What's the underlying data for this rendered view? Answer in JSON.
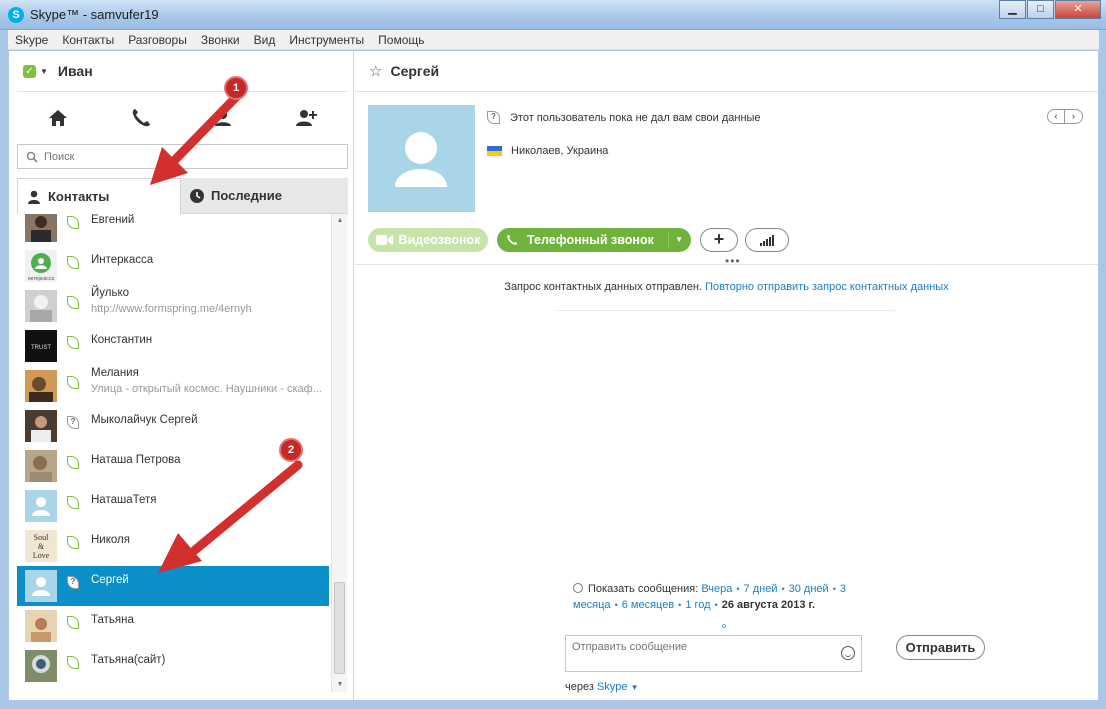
{
  "window": {
    "title": "Skype™ - samvufer19",
    "minimize": "▁",
    "maximize": "□",
    "close": "✕"
  },
  "menu": [
    "Skype",
    "Контакты",
    "Разговоры",
    "Звонки",
    "Вид",
    "Инструменты",
    "Помощь"
  ],
  "me": {
    "name": "Иван",
    "status_icon": "online-check-icon"
  },
  "search": {
    "placeholder": "Поиск"
  },
  "tabs": {
    "contacts": "Контакты",
    "recent": "Последние"
  },
  "contacts": [
    {
      "name": "Евгений",
      "mood": "",
      "status": "online",
      "avatar_color": "#6b5a4e"
    },
    {
      "name": "Интеркасса",
      "mood": "",
      "status": "online",
      "avatar_color": "#4caf50"
    },
    {
      "name": "Йулько",
      "mood": "http://www.formspring.me/4ernyh",
      "status": "online",
      "avatar_color": "#bdbdbd"
    },
    {
      "name": "Константин",
      "mood": "",
      "status": "online",
      "avatar_color": "#111111"
    },
    {
      "name": "Мелания",
      "mood": "Улица - открытый космос. Наушники - скаф...",
      "status": "online",
      "avatar_color": "#c28a48"
    },
    {
      "name": "Мыколайчук Сергей",
      "mood": "",
      "status": "unknown",
      "avatar_color": "#4a3c30"
    },
    {
      "name": "Наташа Петрова",
      "mood": "",
      "status": "online",
      "avatar_color": "#9d8a72"
    },
    {
      "name": "НаташаТетя",
      "mood": "",
      "status": "online",
      "avatar_color": "#a9d5e8"
    },
    {
      "name": "Николя",
      "mood": "",
      "status": "online",
      "avatar_color": "#f1e6cf"
    },
    {
      "name": "Сергей",
      "mood": "",
      "status": "unknown",
      "avatar_color": "#a9d5e8",
      "selected": true
    },
    {
      "name": "Татьяна",
      "mood": "",
      "status": "online",
      "avatar_color": "#d8b48c"
    },
    {
      "name": "Татьяна(сайт)",
      "mood": "",
      "status": "online",
      "avatar_color": "#7f8c6a"
    }
  ],
  "nikolya_avatar_text": [
    "Soul",
    "&",
    "Love"
  ],
  "konstantin_avatar_text": "TRUST",
  "interkassa_avatar_text": "интеркасса",
  "profile": {
    "name": "Сергей",
    "no_data": "Этот пользователь пока не дал вам свои данные",
    "location": "Николаев, Украина",
    "pager_prev": "‹",
    "pager_next": "›"
  },
  "actions": {
    "video": "Видеозвонок",
    "call": "Телефонный звонок",
    "plus": "+"
  },
  "request": {
    "text": "Запрос контактных данных отправлен.",
    "link": "Повторно отправить запрос контактных данных"
  },
  "history": {
    "label": "Показать сообщения:",
    "links": [
      "Вчера",
      "7 дней",
      "30 дней",
      "3 месяца",
      "6 месяцев",
      "1 год"
    ],
    "current": "26 августа 2013 г."
  },
  "compose": {
    "placeholder": "Отправить сообщение",
    "send": "Отправить",
    "via_prefix": "через",
    "via_link": "Skype"
  },
  "annotations": [
    "1",
    "2"
  ],
  "colors": {
    "accent": "#00aff0",
    "selected_row": "#0b8fc8",
    "call_green": "#6fb33c",
    "link": "#1a7fc1",
    "arrow_red": "#d32f2f"
  }
}
